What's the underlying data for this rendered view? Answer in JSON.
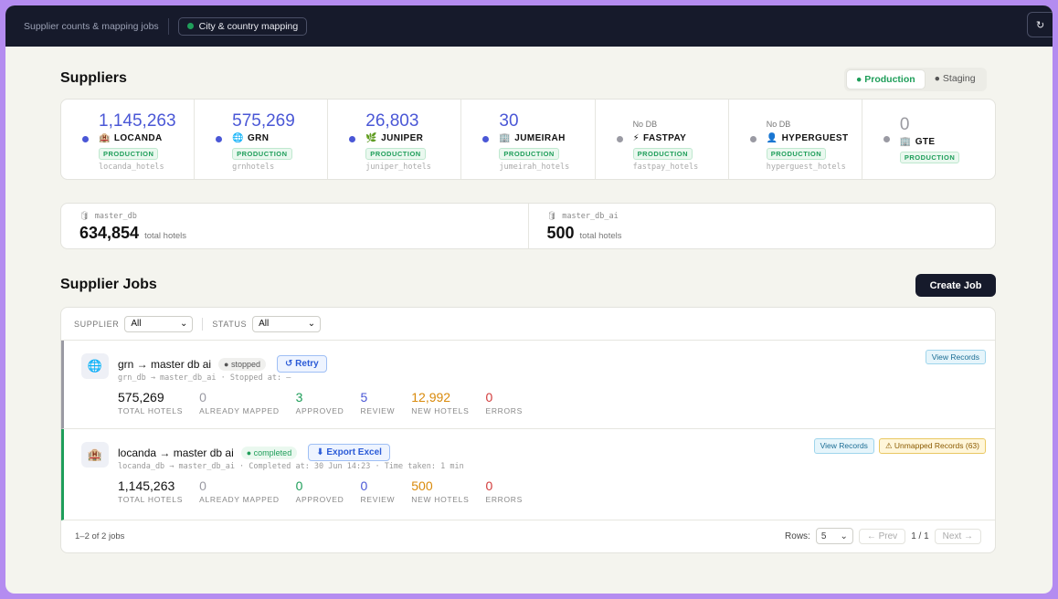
{
  "topbar": {
    "crumb": "Supplier counts & mapping jobs",
    "chip": "City & country mapping",
    "refresh": "↻"
  },
  "suppliers_title": "Suppliers",
  "env": {
    "production": "● Production",
    "staging": "● Staging"
  },
  "suppliers": [
    {
      "count": "1,145,263",
      "nodb": "",
      "name": "LOCANDA",
      "icon": "🏨",
      "badge": "PRODUCTION",
      "table": "locanda_hotels",
      "dot": "#4a57d6"
    },
    {
      "count": "575,269",
      "nodb": "",
      "name": "GRN",
      "icon": "🌐",
      "badge": "PRODUCTION",
      "table": "grnhotels",
      "dot": "#4a57d6"
    },
    {
      "count": "26,803",
      "nodb": "",
      "name": "JUNIPER",
      "icon": "🌿",
      "badge": "PRODUCTION",
      "table": "juniper_hotels",
      "dot": "#4a57d6"
    },
    {
      "count": "30",
      "nodb": "",
      "name": "JUMEIRAH",
      "icon": "🏢",
      "badge": "PRODUCTION",
      "table": "jumeirah_hotels",
      "dot": "#4a57d6"
    },
    {
      "count": "",
      "nodb": "No DB",
      "name": "FASTPAY",
      "icon": "⚡",
      "badge": "PRODUCTION",
      "table": "fastpay_hotels",
      "dot": "#9a9aa3"
    },
    {
      "count": "",
      "nodb": "No DB",
      "name": "HYPERGUEST",
      "icon": "👤",
      "badge": "PRODUCTION",
      "table": "hyperguest_hotels",
      "dot": "#9a9aa3"
    },
    {
      "count": "0",
      "nodb": "",
      "name": "GTE",
      "icon": "🏢",
      "badge": "PRODUCTION",
      "table": "",
      "dot": "#9a9aa3"
    }
  ],
  "dbs": [
    {
      "label": "master_db",
      "value": "634,854",
      "unit": "total hotels"
    },
    {
      "label": "master_db_ai",
      "value": "500",
      "unit": "total hotels"
    }
  ],
  "jobs_title": "Supplier Jobs",
  "create_job": "Create Job",
  "filters": {
    "supplier_label": "SUPPLIER",
    "supplier_value": "All",
    "status_label": "STATUS",
    "status_value": "All"
  },
  "jobs": [
    {
      "title": "grn → master db ai",
      "status": "● stopped",
      "action": "↺ Retry",
      "sub": "grn_db → master_db_ai · Stopped at: —",
      "view_records": "View Records",
      "unmapped": "",
      "stats": [
        {
          "n": "575,269",
          "k": "TOTAL HOTELS",
          "color": "#111"
        },
        {
          "n": "0",
          "k": "ALREADY MAPPED",
          "color": "#9a9aa3"
        },
        {
          "n": "3",
          "k": "APPROVED",
          "color": "#1f9e5a"
        },
        {
          "n": "5",
          "k": "REVIEW",
          "color": "#4a57d6"
        },
        {
          "n": "12,992",
          "k": "NEW HOTELS",
          "color": "#d98a0b"
        },
        {
          "n": "0",
          "k": "ERRORS",
          "color": "#d23b3b"
        }
      ]
    },
    {
      "title": "locanda → master db ai",
      "status": "● completed",
      "action": "⬇ Export Excel",
      "sub": "locanda_db → master_db_ai · Completed at: 30 Jun 14:23 · Time taken: 1 min",
      "view_records": "View Records",
      "unmapped": "⚠ Unmapped Records (63)",
      "stats": [
        {
          "n": "1,145,263",
          "k": "TOTAL HOTELS",
          "color": "#111"
        },
        {
          "n": "0",
          "k": "ALREADY MAPPED",
          "color": "#9a9aa3"
        },
        {
          "n": "0",
          "k": "APPROVED",
          "color": "#1f9e5a"
        },
        {
          "n": "0",
          "k": "REVIEW",
          "color": "#4a57d6"
        },
        {
          "n": "500",
          "k": "NEW HOTELS",
          "color": "#d98a0b"
        },
        {
          "n": "0",
          "k": "ERRORS",
          "color": "#d23b3b"
        }
      ]
    }
  ],
  "footer": {
    "count": "1–2 of 2 jobs",
    "rows_label": "Rows:",
    "rows_value": "5",
    "prev": "← Prev",
    "page": "1 / 1",
    "next": "Next →"
  }
}
